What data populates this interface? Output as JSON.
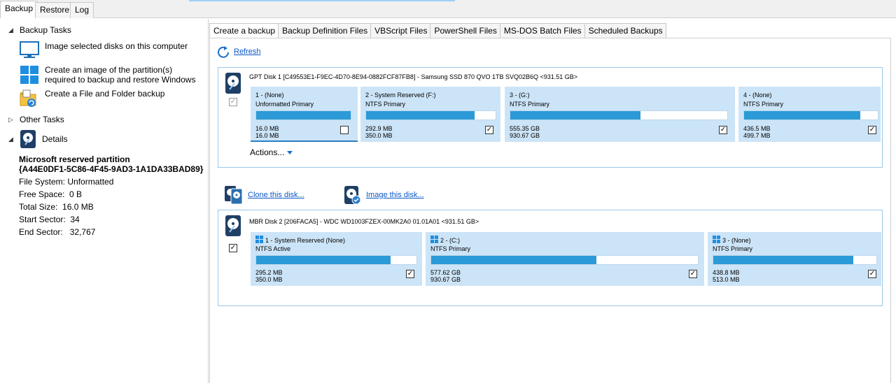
{
  "main_tabs": [
    {
      "label": "Backup",
      "active": true
    },
    {
      "label": "Restore",
      "active": false
    },
    {
      "label": "Log",
      "active": false
    }
  ],
  "left": {
    "backup_tasks_title": "Backup Tasks",
    "tasks": [
      {
        "label": "Image selected disks on this computer",
        "icon": "monitor-icon"
      },
      {
        "label": "Create an image of the partition(s) required to backup and restore Windows",
        "icon": "windows-icon"
      },
      {
        "label": "Create a File and Folder backup",
        "icon": "folder-backup-icon"
      }
    ],
    "other_tasks_title": "Other Tasks",
    "details_title": "Details",
    "details": {
      "name": "Microsoft reserved partition",
      "guid": "{A44E0DF1-5C86-4F45-9AD3-1A1DA33BAD89}",
      "rows": [
        {
          "key": "File System:",
          "value": "Unformatted"
        },
        {
          "key": "Free Space:",
          "value": "0 B"
        },
        {
          "key": "Total Size:",
          "value": "16.0 MB"
        },
        {
          "key": "Start Sector:",
          "value": "34"
        },
        {
          "key": "End Sector:",
          "value": "32,767"
        }
      ]
    }
  },
  "sub_tabs": [
    {
      "label": "Create a backup",
      "active": true
    },
    {
      "label": "Backup Definition Files",
      "active": false
    },
    {
      "label": "VBScript Files",
      "active": false
    },
    {
      "label": "PowerShell Files",
      "active": false
    },
    {
      "label": "MS-DOS Batch Files",
      "active": false
    },
    {
      "label": "Scheduled Backups",
      "active": false
    }
  ],
  "refresh_label": "Refresh",
  "disks": [
    {
      "label": "GPT Disk 1 [C49553E1-F9EC-4D70-8E94-0882FCF87FB8] - Samsung SSD 870 QVO 1TB SVQ02B6Q  <931.51 GB>",
      "checked": true,
      "partitions": [
        {
          "name": "1 -  (None)",
          "type": "Unformatted Primary",
          "used": "16.0 MB",
          "total": "16.0 MB",
          "fill": 1.0,
          "checked": false,
          "win": false
        },
        {
          "name": "2 - System Reserved (F:)",
          "type": "NTFS Primary",
          "used": "292.9 MB",
          "total": "350.0 MB",
          "fill": 0.84,
          "checked": true,
          "win": false
        },
        {
          "name": "3 -  (G:)",
          "type": "NTFS Primary",
          "used": "555.35 GB",
          "total": "930.67 GB",
          "fill": 0.6,
          "checked": true,
          "win": false
        },
        {
          "name": "4 -  (None)",
          "type": "NTFS Primary",
          "used": "436.5 MB",
          "total": "499.7 MB",
          "fill": 0.87,
          "checked": true,
          "win": false
        }
      ]
    },
    {
      "label": "MBR Disk 2 [206FACA5] - WDC WD1003FZEX-00MK2A0 01.01A01  <931.51 GB>",
      "checked": true,
      "partitions": [
        {
          "name": "1 - System Reserved (None)",
          "type": "NTFS Active",
          "used": "295.2 MB",
          "total": "350.0 MB",
          "fill": 0.84,
          "checked": true,
          "win": true
        },
        {
          "name": "2 - (C:)",
          "type": "NTFS Primary",
          "used": "577.62 GB",
          "total": "930.67 GB",
          "fill": 0.62,
          "checked": true,
          "win": true
        },
        {
          "name": "3 -  (None)",
          "type": "NTFS Primary",
          "used": "438.8 MB",
          "total": "513.0 MB",
          "fill": 0.86,
          "checked": true,
          "win": true
        }
      ]
    }
  ],
  "actions_label": "Actions...",
  "clone_label": "Clone this disk...",
  "image_label": "Image this disk...",
  "colors": {
    "accent": "#2b9ad6",
    "partition_bg": "#cce4f7",
    "link": "#0b57c5"
  }
}
